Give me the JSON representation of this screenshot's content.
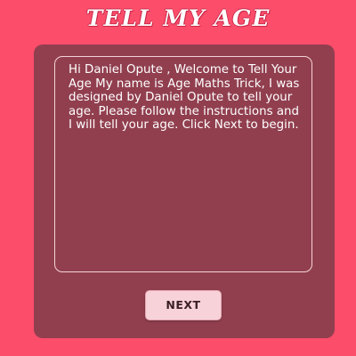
{
  "header": {
    "title": "TELL MY AGE"
  },
  "main": {
    "message": "Hi Daniel Opute , Welcome to Tell Your Age My name is Age Maths Trick, I was designed by Daniel Opute to tell your age. Please follow the instructions and I will tell your age. Click Next to begin.",
    "next_label": "NEXT"
  }
}
